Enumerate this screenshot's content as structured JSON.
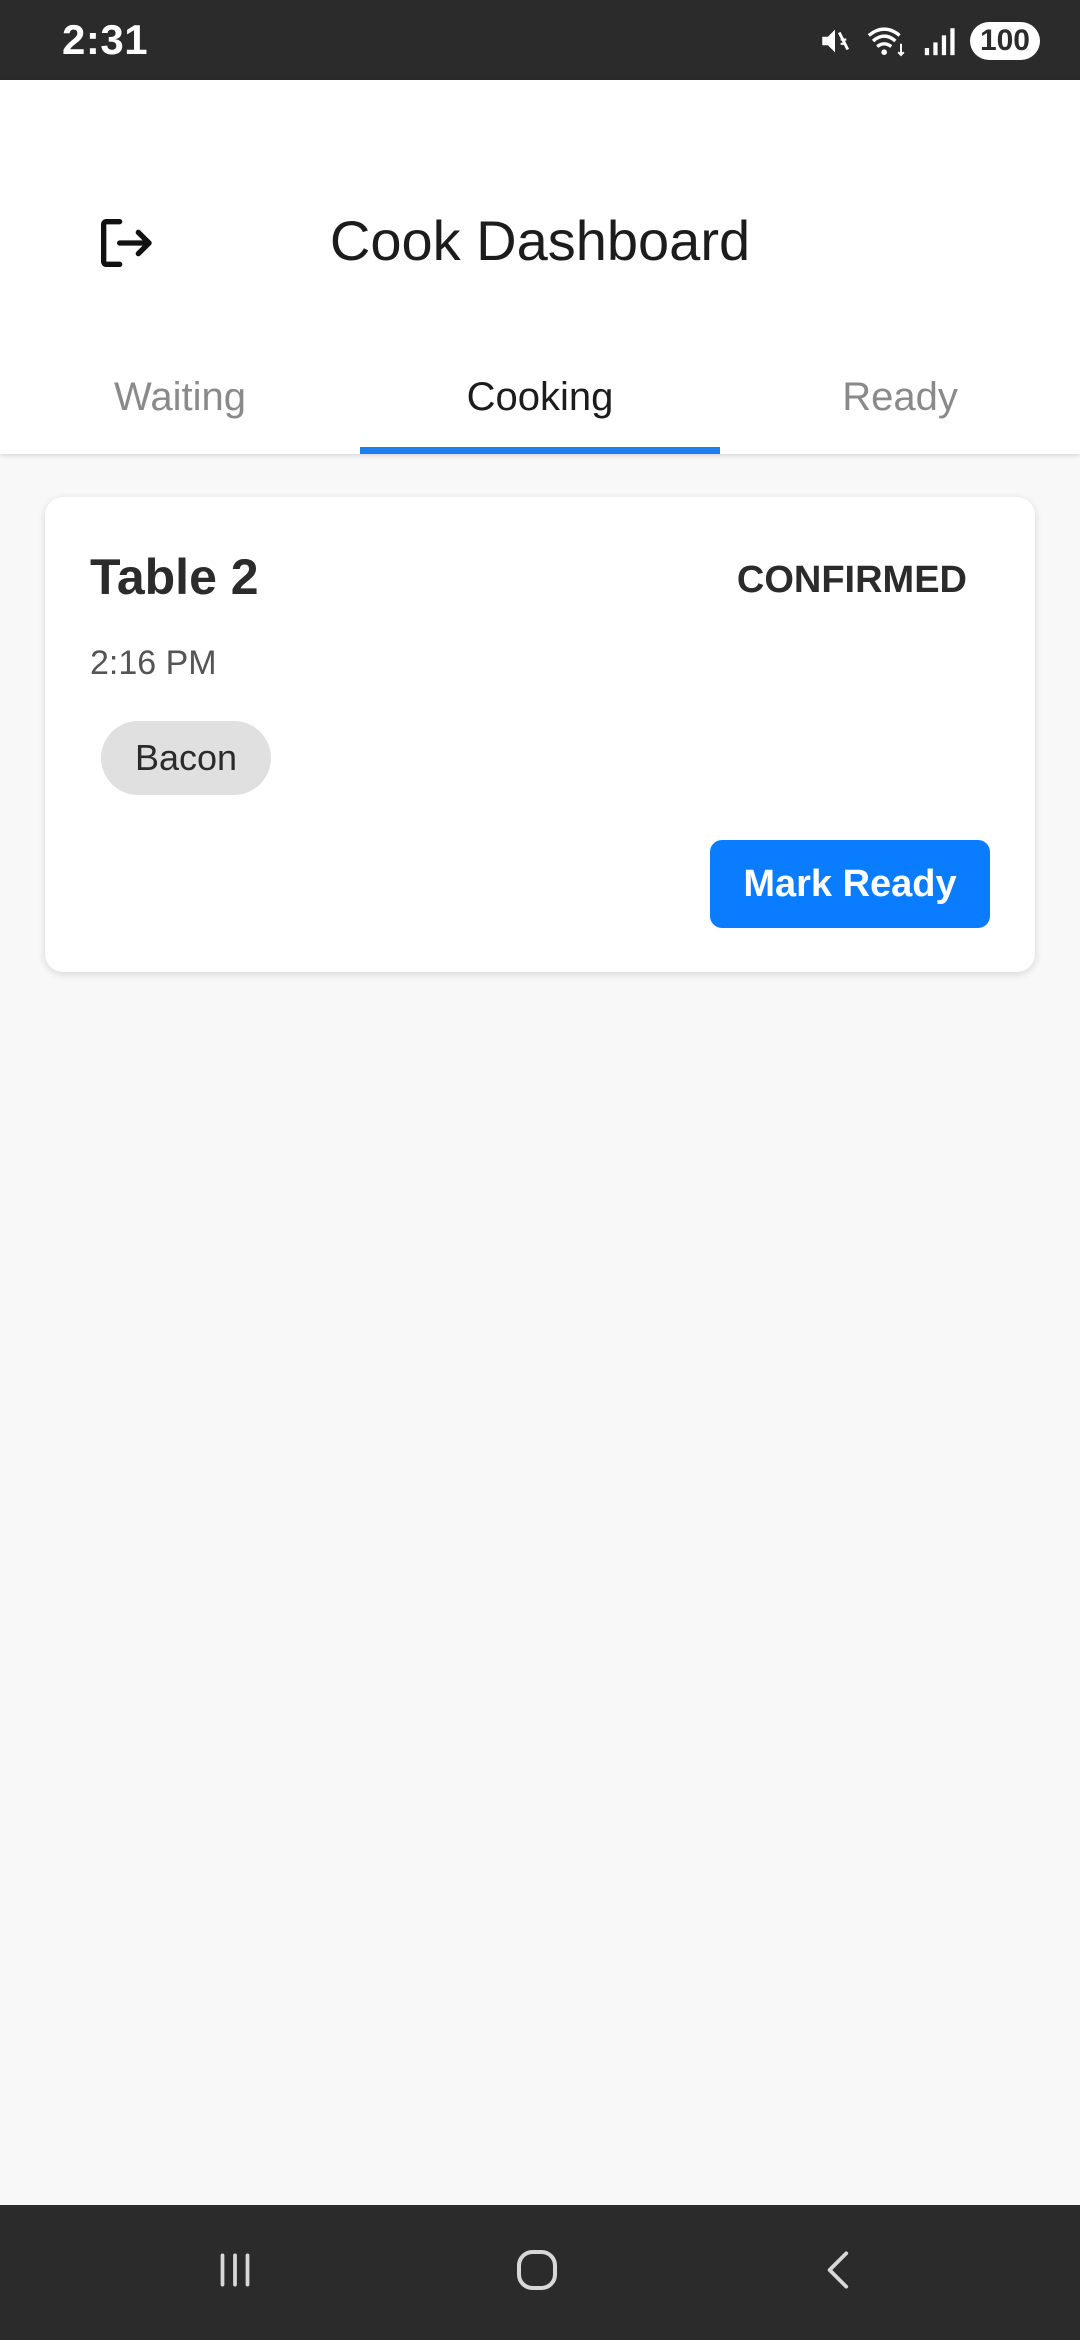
{
  "status_bar": {
    "time": "2:31",
    "battery": "100",
    "icons": [
      "mute-icon",
      "wifi-icon",
      "signal-icon",
      "battery-icon"
    ]
  },
  "header": {
    "title": "Cook Dashboard",
    "logout_icon": "logout-icon"
  },
  "tabs": [
    {
      "label": "Waiting",
      "active": false
    },
    {
      "label": "Cooking",
      "active": true
    },
    {
      "label": "Ready",
      "active": false
    }
  ],
  "orders": [
    {
      "table": "Table 2",
      "status": "CONFIRMED",
      "time": "2:16 PM",
      "items": [
        "Bacon"
      ],
      "action_label": "Mark Ready"
    }
  ],
  "nav_bar": {
    "buttons": [
      "recents-icon",
      "home-icon",
      "back-icon"
    ]
  },
  "colors": {
    "accent": "#0a7cff",
    "tab_indicator": "#1a7ff0",
    "background": "#f8f8f8",
    "system_bar": "#2b2b2b"
  }
}
